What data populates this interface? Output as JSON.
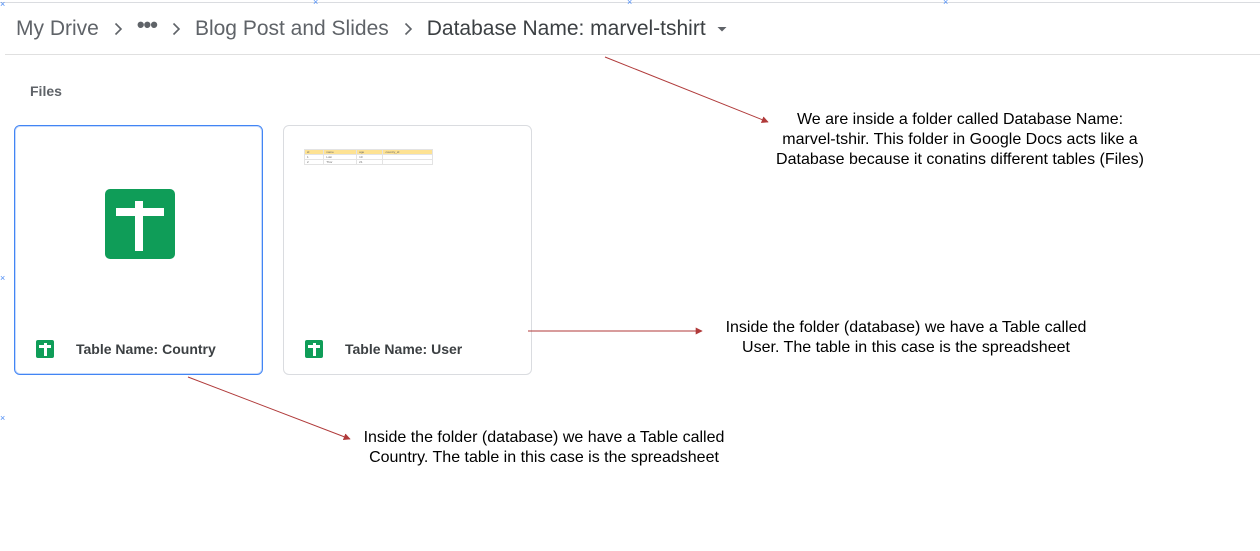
{
  "breadcrumb": {
    "root": "My Drive",
    "more": "•••",
    "parent": "Blog Post and Slides",
    "current": "Database Name: marvel-tshirt"
  },
  "section": {
    "label": "Files"
  },
  "files": [
    {
      "name": "Table Name: Country",
      "type": "spreadsheet",
      "preview_icon": "google-sheets-icon",
      "selected": true
    },
    {
      "name": "Table Name: User",
      "type": "spreadsheet",
      "preview_icon": "spreadsheet-thumbnail",
      "selected": false,
      "thumbnail": {
        "header": [
          "id",
          "name",
          "age",
          "country_id"
        ],
        "rows": [
          [
            "1",
            "Loki",
            "10",
            ""
          ],
          [
            "2",
            "Thor",
            "21",
            ""
          ]
        ]
      }
    }
  ],
  "annotations": {
    "folder": "We are inside a folder called Database Name: marvel-tshir. This folder in Google Docs acts like a Database because it conatins different tables (Files)",
    "user": "Inside the folder (database) we have a Table called User. The table in this case is the spreadsheet",
    "country": "Inside the folder (database) we have a Table called Country. The table in this case is the spreadsheet"
  },
  "colors": {
    "sheets_green": "#0f9d58",
    "selection_blue": "#4285f4",
    "arrow_red": "#b03a3a",
    "text_gray": "#5f6368"
  },
  "icons": {
    "separator": "chevron-right-icon",
    "dropdown": "caret-down-icon",
    "file_type": "google-sheets-icon"
  }
}
